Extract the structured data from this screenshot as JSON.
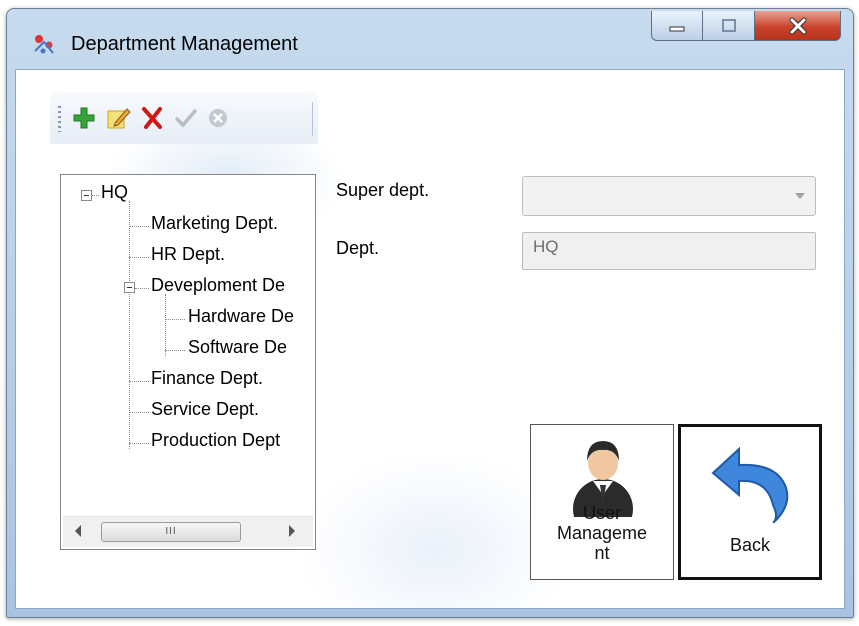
{
  "window": {
    "title": "Department Management",
    "colors": {
      "title_bar": "#b9d1ea",
      "close_button": "#c9442b",
      "client_background": "#ffffff"
    }
  },
  "title_bar_controls": [
    {
      "name": "minimize",
      "icon": "minimize-icon"
    },
    {
      "name": "maximize",
      "icon": "maximize-icon"
    },
    {
      "name": "close",
      "icon": "close-icon"
    }
  ],
  "toolbar": {
    "buttons": [
      {
        "name": "add",
        "icon": "plus-icon",
        "color": "#2e9e2e",
        "enabled": true
      },
      {
        "name": "edit",
        "icon": "edit-icon",
        "color": "#e0b020",
        "enabled": true
      },
      {
        "name": "delete",
        "icon": "x-icon",
        "color": "#d01818",
        "enabled": true
      },
      {
        "name": "confirm",
        "icon": "check-icon",
        "color": "#b8bec6",
        "enabled": false
      },
      {
        "name": "cancel",
        "icon": "cancel-icon",
        "color": "#b8bec6",
        "enabled": false
      }
    ]
  },
  "tree": {
    "nodes": [
      {
        "label": "HQ",
        "level": 0,
        "expanded": true
      },
      {
        "label": "Marketing Dept.",
        "level": 1
      },
      {
        "label": "HR Dept.",
        "level": 1
      },
      {
        "label": "Deveploment De",
        "level": 1,
        "expanded": true
      },
      {
        "label": "Hardware De",
        "level": 2
      },
      {
        "label": "Software De",
        "level": 2
      },
      {
        "label": "Finance Dept.",
        "level": 1
      },
      {
        "label": "Service Dept.",
        "level": 1
      },
      {
        "label": "Production Dept",
        "level": 1
      }
    ],
    "scrollbar_thumb_label": "III"
  },
  "form": {
    "super_dept_label": "Super dept.",
    "super_dept_value": "",
    "dept_label": "Dept.",
    "dept_value": "HQ"
  },
  "buttons": {
    "user_management": {
      "line1": "User",
      "line2": "Manageme",
      "line3": "nt",
      "icon": "user-icon"
    },
    "back": {
      "label": "Back",
      "icon": "back-arrow-icon"
    }
  }
}
